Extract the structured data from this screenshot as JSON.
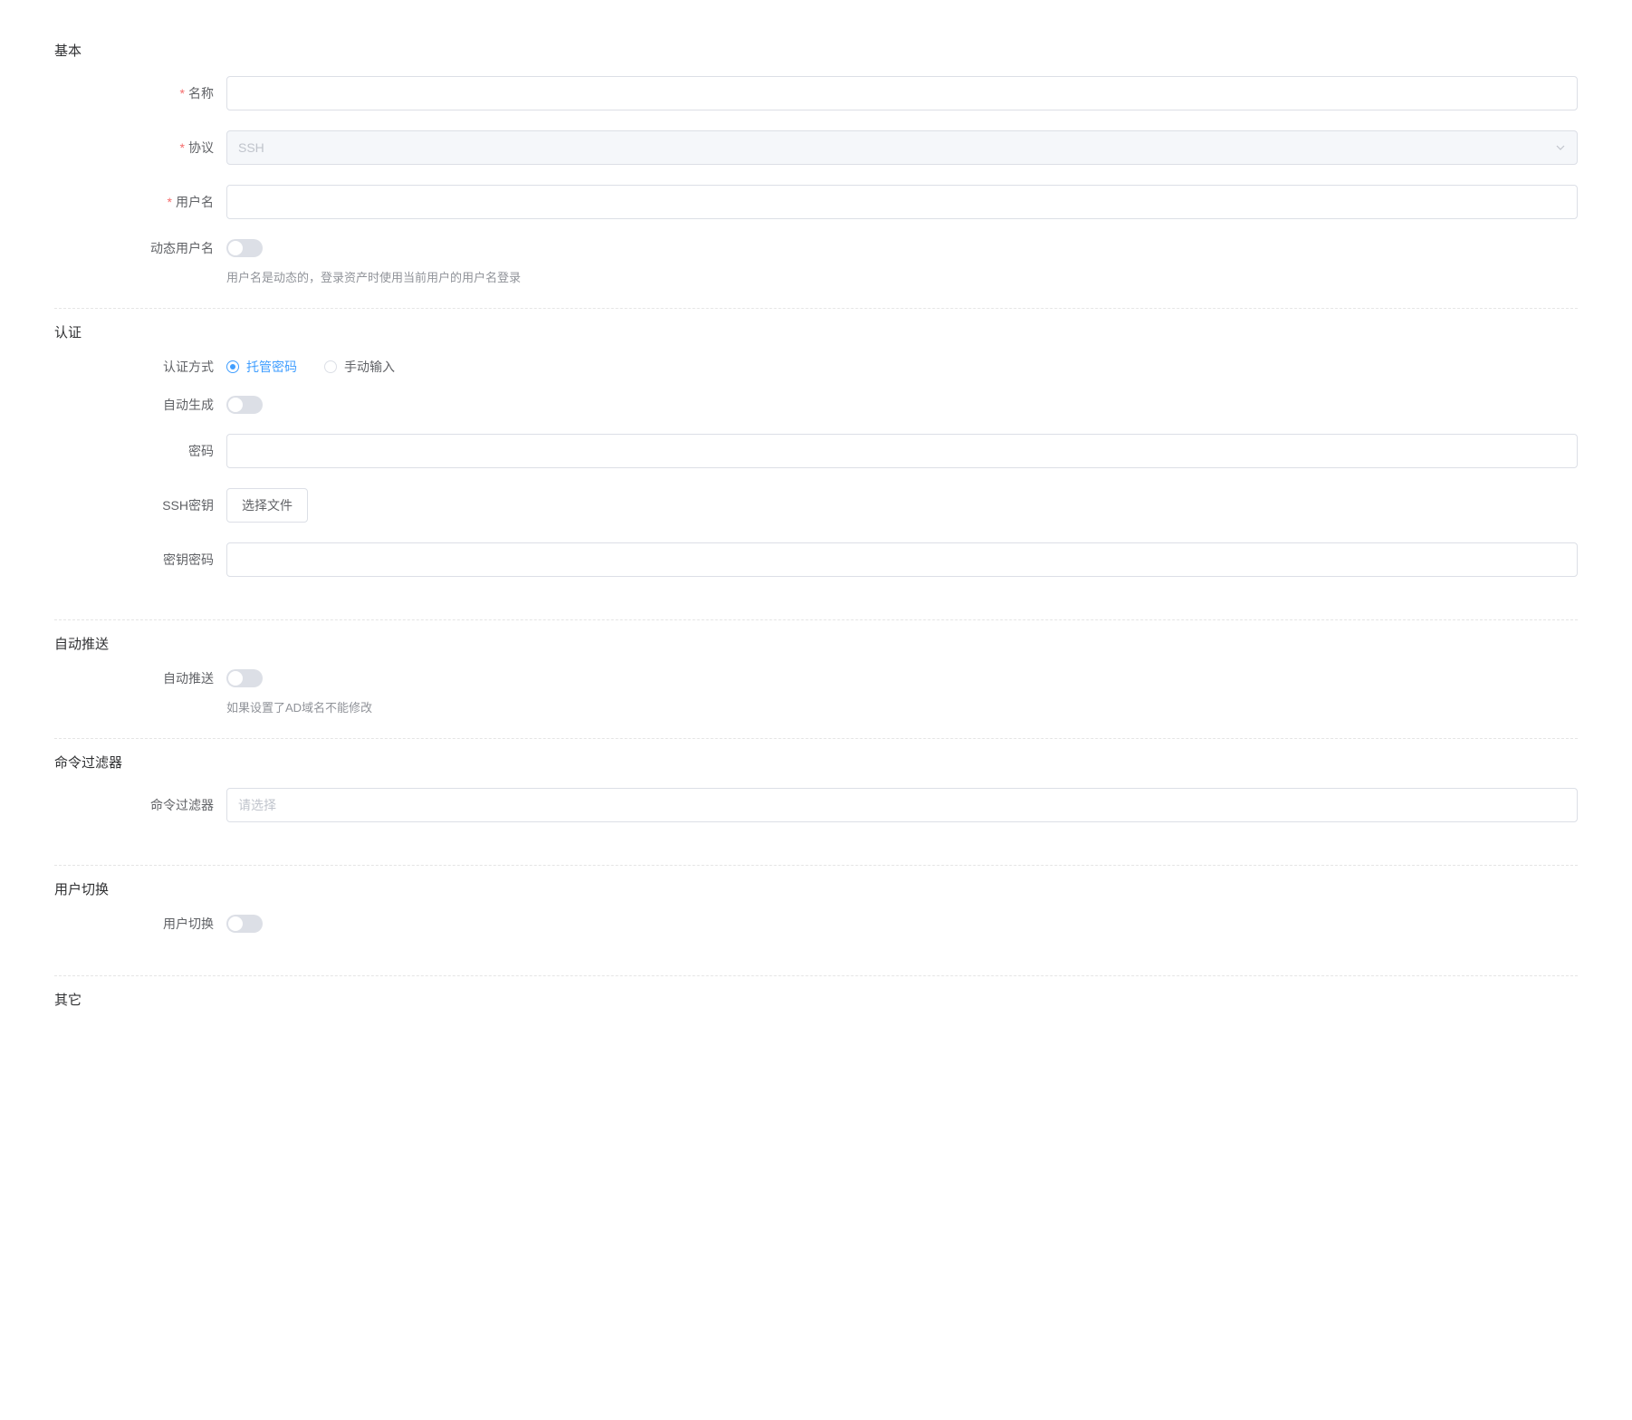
{
  "sections": {
    "basic": {
      "title": "基本",
      "fields": {
        "name": {
          "label": "名称",
          "value": ""
        },
        "protocol": {
          "label": "协议",
          "value": "SSH"
        },
        "username": {
          "label": "用户名",
          "value": ""
        },
        "dynamic_username": {
          "label": "动态用户名",
          "help": "用户名是动态的，登录资产时使用当前用户的用户名登录"
        }
      }
    },
    "auth": {
      "title": "认证",
      "fields": {
        "auth_method": {
          "label": "认证方式",
          "options": {
            "managed": "托管密码",
            "manual": "手动输入"
          }
        },
        "auto_generate": {
          "label": "自动生成"
        },
        "password": {
          "label": "密码",
          "value": ""
        },
        "ssh_key": {
          "label": "SSH密钥",
          "button": "选择文件"
        },
        "key_password": {
          "label": "密钥密码",
          "value": ""
        }
      }
    },
    "auto_push": {
      "title": "自动推送",
      "fields": {
        "auto_push": {
          "label": "自动推送",
          "help": "如果设置了AD域名不能修改"
        }
      }
    },
    "command_filter": {
      "title": "命令过滤器",
      "fields": {
        "filter": {
          "label": "命令过滤器",
          "placeholder": "请选择"
        }
      }
    },
    "user_switch": {
      "title": "用户切换",
      "fields": {
        "switch": {
          "label": "用户切换"
        }
      }
    },
    "other": {
      "title": "其它"
    }
  }
}
